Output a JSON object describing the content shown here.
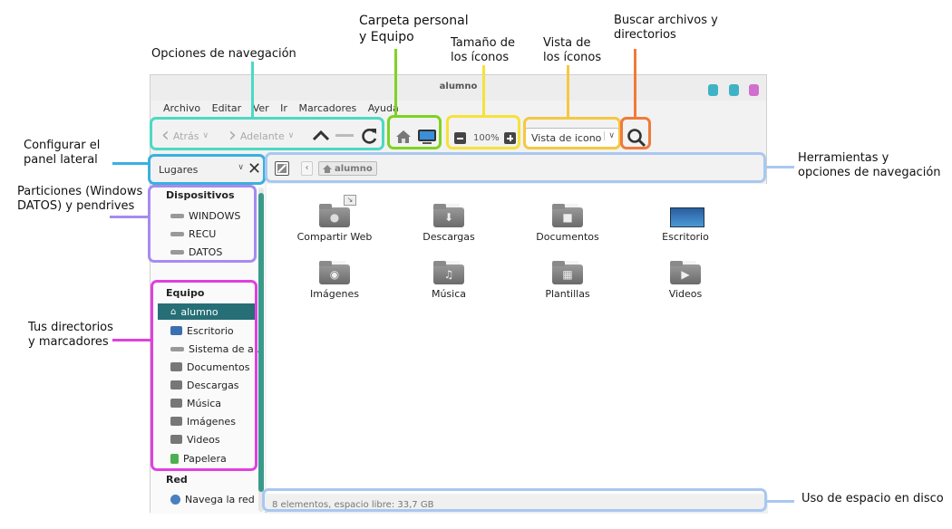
{
  "window": {
    "title": "alumno",
    "menu": [
      "Archivo",
      "Editar",
      "Ver",
      "Ir",
      "Marcadores",
      "Ayuda"
    ],
    "toolbar": {
      "back_label": "Atrás",
      "forward_label": "Adelante",
      "zoom_value": "100%",
      "view_mode": "Vista de icono"
    },
    "places_selector": "Lugares",
    "breadcrumb": "alumno",
    "sidebar": {
      "devices_title": "Dispositivos",
      "devices": [
        "WINDOWS",
        "RECU",
        "DATOS"
      ],
      "computer_title": "Equipo",
      "computer_items": [
        "alumno",
        "Escritorio",
        "Sistema de a...",
        "Documentos",
        "Descargas",
        "Música",
        "Imágenes",
        "Videos",
        "Papelera"
      ],
      "network_title": "Red",
      "network_items": [
        "Navega la red"
      ]
    },
    "files": [
      "Compartir Web",
      "Descargas",
      "Documentos",
      "Escritorio",
      "Imágenes",
      "Música",
      "Plantillas",
      "Videos"
    ],
    "status": "8 elementos, espacio libre: 33,7 GB"
  },
  "callouts": {
    "nav_options": "Opciones de navegación",
    "home_computer_1": "Carpeta personal",
    "home_computer_2": "y Equipo",
    "icon_size_1": "Tamaño de",
    "icon_size_2": "los íconos",
    "icon_view_1": "Vista de",
    "icon_view_2": "los íconos",
    "search_1": "Buscar archivos y",
    "search_2": "directorios",
    "sidebar_config_1": "Configurar el",
    "sidebar_config_2": "panel lateral",
    "partitions_1": "Particiones (Windows",
    "partitions_2": "DATOS) y pendrives",
    "dirs_1": "Tus directorios",
    "dirs_2": "y marcadores",
    "tools_1": "Herramientas y",
    "tools_2": "opciones de navegación",
    "disk_usage": "Uso de espacio en disco"
  },
  "colors": {
    "nav_box": "#4dd9c4",
    "home_box": "#7ed321",
    "size_box": "#f5e23a",
    "view_box": "#f5c842",
    "search_box": "#f07a3a",
    "sidebar_config_box": "#3ab0e0",
    "partitions_box": "#a78bf0",
    "dirs_box": "#e040e0",
    "tools_box": "#a9c8f0",
    "disk_box": "#a9c8f0",
    "selected_item": "#266f77"
  }
}
